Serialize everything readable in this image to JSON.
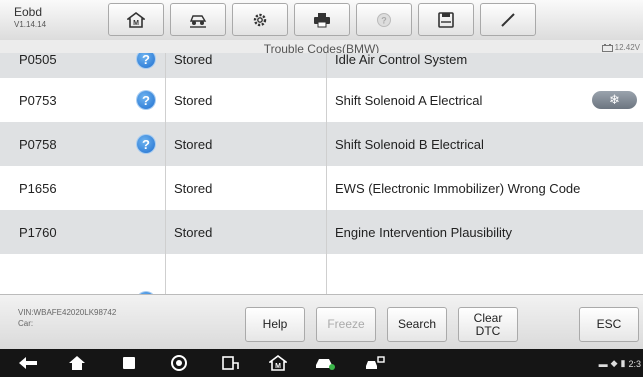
{
  "app": {
    "name": "Eobd",
    "version": "V1.14.14"
  },
  "toolbar": {
    "buttons": [
      {
        "icon": "home-icon"
      },
      {
        "icon": "vehicle-lift-icon"
      },
      {
        "icon": "settings-gear-icon"
      },
      {
        "icon": "print-icon"
      },
      {
        "icon": "help-disabled-icon"
      },
      {
        "icon": "save-icon"
      },
      {
        "icon": "pen-icon"
      }
    ]
  },
  "page": {
    "title": "Trouble Codes(BMW)",
    "voltage": "12.42V"
  },
  "codes": [
    {
      "code": "P0505",
      "has_help": true,
      "status": "Stored",
      "description": "Idle Air Control System"
    },
    {
      "code": "P0753",
      "has_help": true,
      "status": "Stored",
      "description": "Shift Solenoid A Electrical",
      "freeze_icon": "snowflake-icon"
    },
    {
      "code": "P0758",
      "has_help": true,
      "status": "Stored",
      "description": "Shift Solenoid B Electrical"
    },
    {
      "code": "P1656",
      "has_help": false,
      "status": "Stored",
      "description": "EWS (Electronic Immobilizer) Wrong Code"
    },
    {
      "code": "P1760",
      "has_help": false,
      "status": "Stored",
      "description": "Engine Intervention Plausibility"
    }
  ],
  "footer": {
    "vin": "VIN:WBAFE42020LK98742",
    "car": "Car:",
    "buttons": {
      "help": "Help",
      "freeze": "Freeze",
      "search": "Search",
      "clear_dtc": "Clear DTC",
      "esc": "ESC"
    }
  },
  "system_nav": {
    "icons": [
      "back-icon",
      "home-icon",
      "recent-apps-icon",
      "chrome-icon",
      "connect-icon",
      "maxisys-home-icon",
      "car-icon",
      "vehicle-tools-icon"
    ],
    "time": "2:3"
  },
  "colors": {
    "accent": "#1f6fd0",
    "row_alt": "#dfe1e3",
    "navbar": "#151515"
  }
}
